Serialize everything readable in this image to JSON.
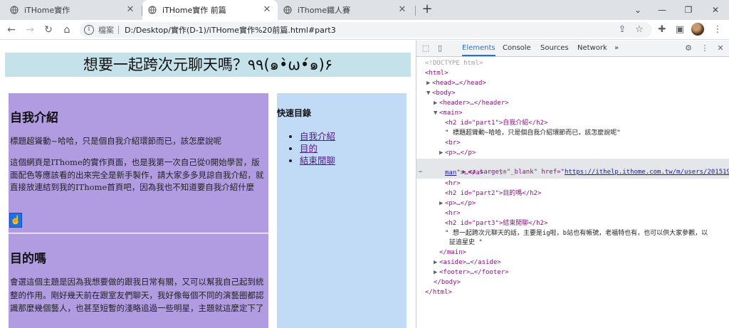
{
  "browser": {
    "tabs": [
      {
        "title": "iTHome實作"
      },
      {
        "title": "iTHome實作 前篇"
      },
      {
        "title": "iThome鐵人賽"
      }
    ],
    "address_scheme": "檔案",
    "address_url": "D:/Desktop/實作(D-1)/iTHome實作%20前篇.html#part3"
  },
  "page": {
    "header_title": "想要一起跨次元聊天嗎？٩٩(๑•̀ω•́๑)۶",
    "section1": {
      "heading": "自我介紹",
      "para1": "標題超聳動~哈哈，只是個自我介紹環節而已，該怎麼說呢",
      "para2": "這個網頁是IThome的實作頁面，也是我第一次自己從0開始學習，版面配色等應該看的出來完全是新手製作，請大家多多見諒自我介紹，就直接放連結到我的IThome首頁吧，因為我也不知道要自我介紹什麼"
    },
    "section2": {
      "heading": "目的嗎",
      "para": "會選這個主題是因為我想要做的跟我日常有關，又可以幫我自己起到統整的作用。剛好幾天前在跟室友們聊天，我好像每個不同的演藝圈都認識那麼幾個藝人，也甚至短暫的淺略追過一些明星，主題就這麼定下了"
    },
    "aside": {
      "title": "快速目錄",
      "links": [
        "自我介紹",
        "目的",
        "結束閒聊"
      ]
    }
  },
  "devtools": {
    "tabs": [
      "Elements",
      "Console",
      "Sources",
      "Network"
    ],
    "more": "»",
    "dom": {
      "doctype": "<!DOCTYPE html>",
      "html_open": "<html>",
      "head": "<head>…</head>",
      "body_open": "<body>",
      "header": "<header>…</header>",
      "main_open": "<main>",
      "h2_part1": "<h2 id=\"part1\">自我介紹</h2>",
      "text1": "\" 標題超聳動~哈哈，只是個自我介紹環節而已，該怎麼說呢\"",
      "br": "<br>",
      "p1": "<p>…</p>",
      "a_prefix": "<a target=\"_blank\" href=\"",
      "a_href_1": "https://ithelp.ithome.com.tw/m/users/20151919/iron",
      "a_href_2": "man",
      "a_suffix": "\">…</a>",
      "a_eq": "== $0",
      "hr": "<hr>",
      "h2_part2": "<h2 id=\"part2\">目的嗎</h2>",
      "p2": "<p>…</p>",
      "h2_part3": "<h2 id=\"part3\">結束閒聊</h2>",
      "text3a": "\" 想一起跨次元聊天的話，主要是ig啦，b站也有帳號，老福特也有，也可以供大家參觀，以",
      "text3b": "証追星史 \"",
      "main_close": "</main>",
      "aside": "<aside>…</aside>",
      "footer": "<footer>…</footer>",
      "body_close": "</body>",
      "html_close": "</html>"
    }
  }
}
